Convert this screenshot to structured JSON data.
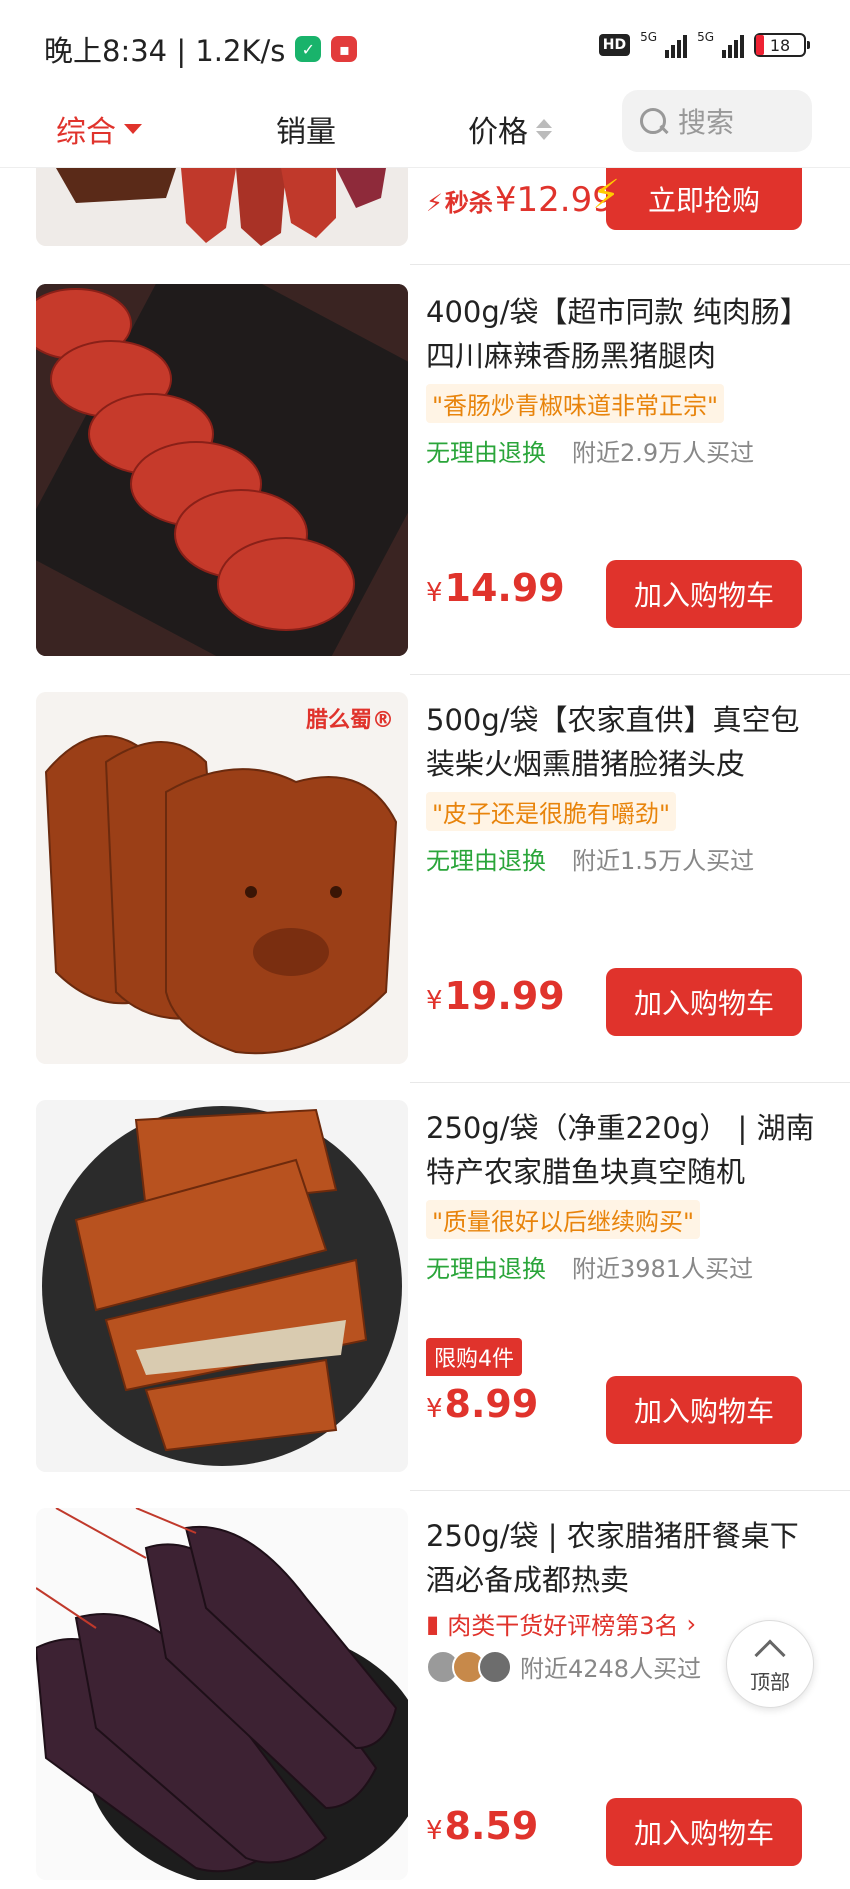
{
  "status_bar": {
    "time_text": "晚上8:34 | 1.2K/s",
    "hd_label": "HD",
    "net_label_1": "5G",
    "net_label_2": "5G",
    "battery": "18"
  },
  "sort_bar": {
    "tabs": [
      {
        "label": "综合",
        "active": true
      },
      {
        "label": "销量"
      },
      {
        "label": "价格"
      }
    ],
    "search_placeholder": "搜索"
  },
  "flash_row": {
    "flash_label": "秒杀",
    "price": "¥12.99",
    "button": "立即抢购"
  },
  "products": [
    {
      "title": "400g/袋【超市同款 纯肉肠】四川麻辣香肠黑猪腿肉",
      "quote": "\"香肠炒青椒味道非常正宗\"",
      "return_text": "无理由退换",
      "sold_text": "附近2.9万人买过",
      "price_symbol": "¥",
      "price": "14.99",
      "cart_label": "加入购物车"
    },
    {
      "title": "500g/袋【农家直供】真空包装柴火烟熏腊猪脸猪头皮",
      "brand": "腊么蜀®",
      "quote": "\"皮子还是很脆有嚼劲\"",
      "return_text": "无理由退换",
      "sold_text": "附近1.5万人买过",
      "price_symbol": "¥",
      "price": "19.99",
      "cart_label": "加入购物车"
    },
    {
      "title": "250g/袋（净重220g） | 湖南特产农家腊鱼块真空随机",
      "quote": "\"质量很好以后继续购买\"",
      "return_text": "无理由退换",
      "sold_text": "附近3981人买过",
      "limit": "限购4件",
      "price_symbol": "¥",
      "price": "8.99",
      "cart_label": "加入购物车"
    },
    {
      "title": "250g/袋 | 农家腊猪肝餐桌下酒必备成都热卖",
      "rank_text": "肉类干货好评榜第3名",
      "sold_text": "附近4248人买过",
      "price_symbol": "¥",
      "price": "8.59",
      "cart_label": "加入购物车"
    }
  ],
  "back_to_top": "顶部",
  "colors": {
    "accent": "#e0332c",
    "green": "#2aa53a",
    "quote_bg": "#fff4e5",
    "quote_text": "#e8840c"
  }
}
